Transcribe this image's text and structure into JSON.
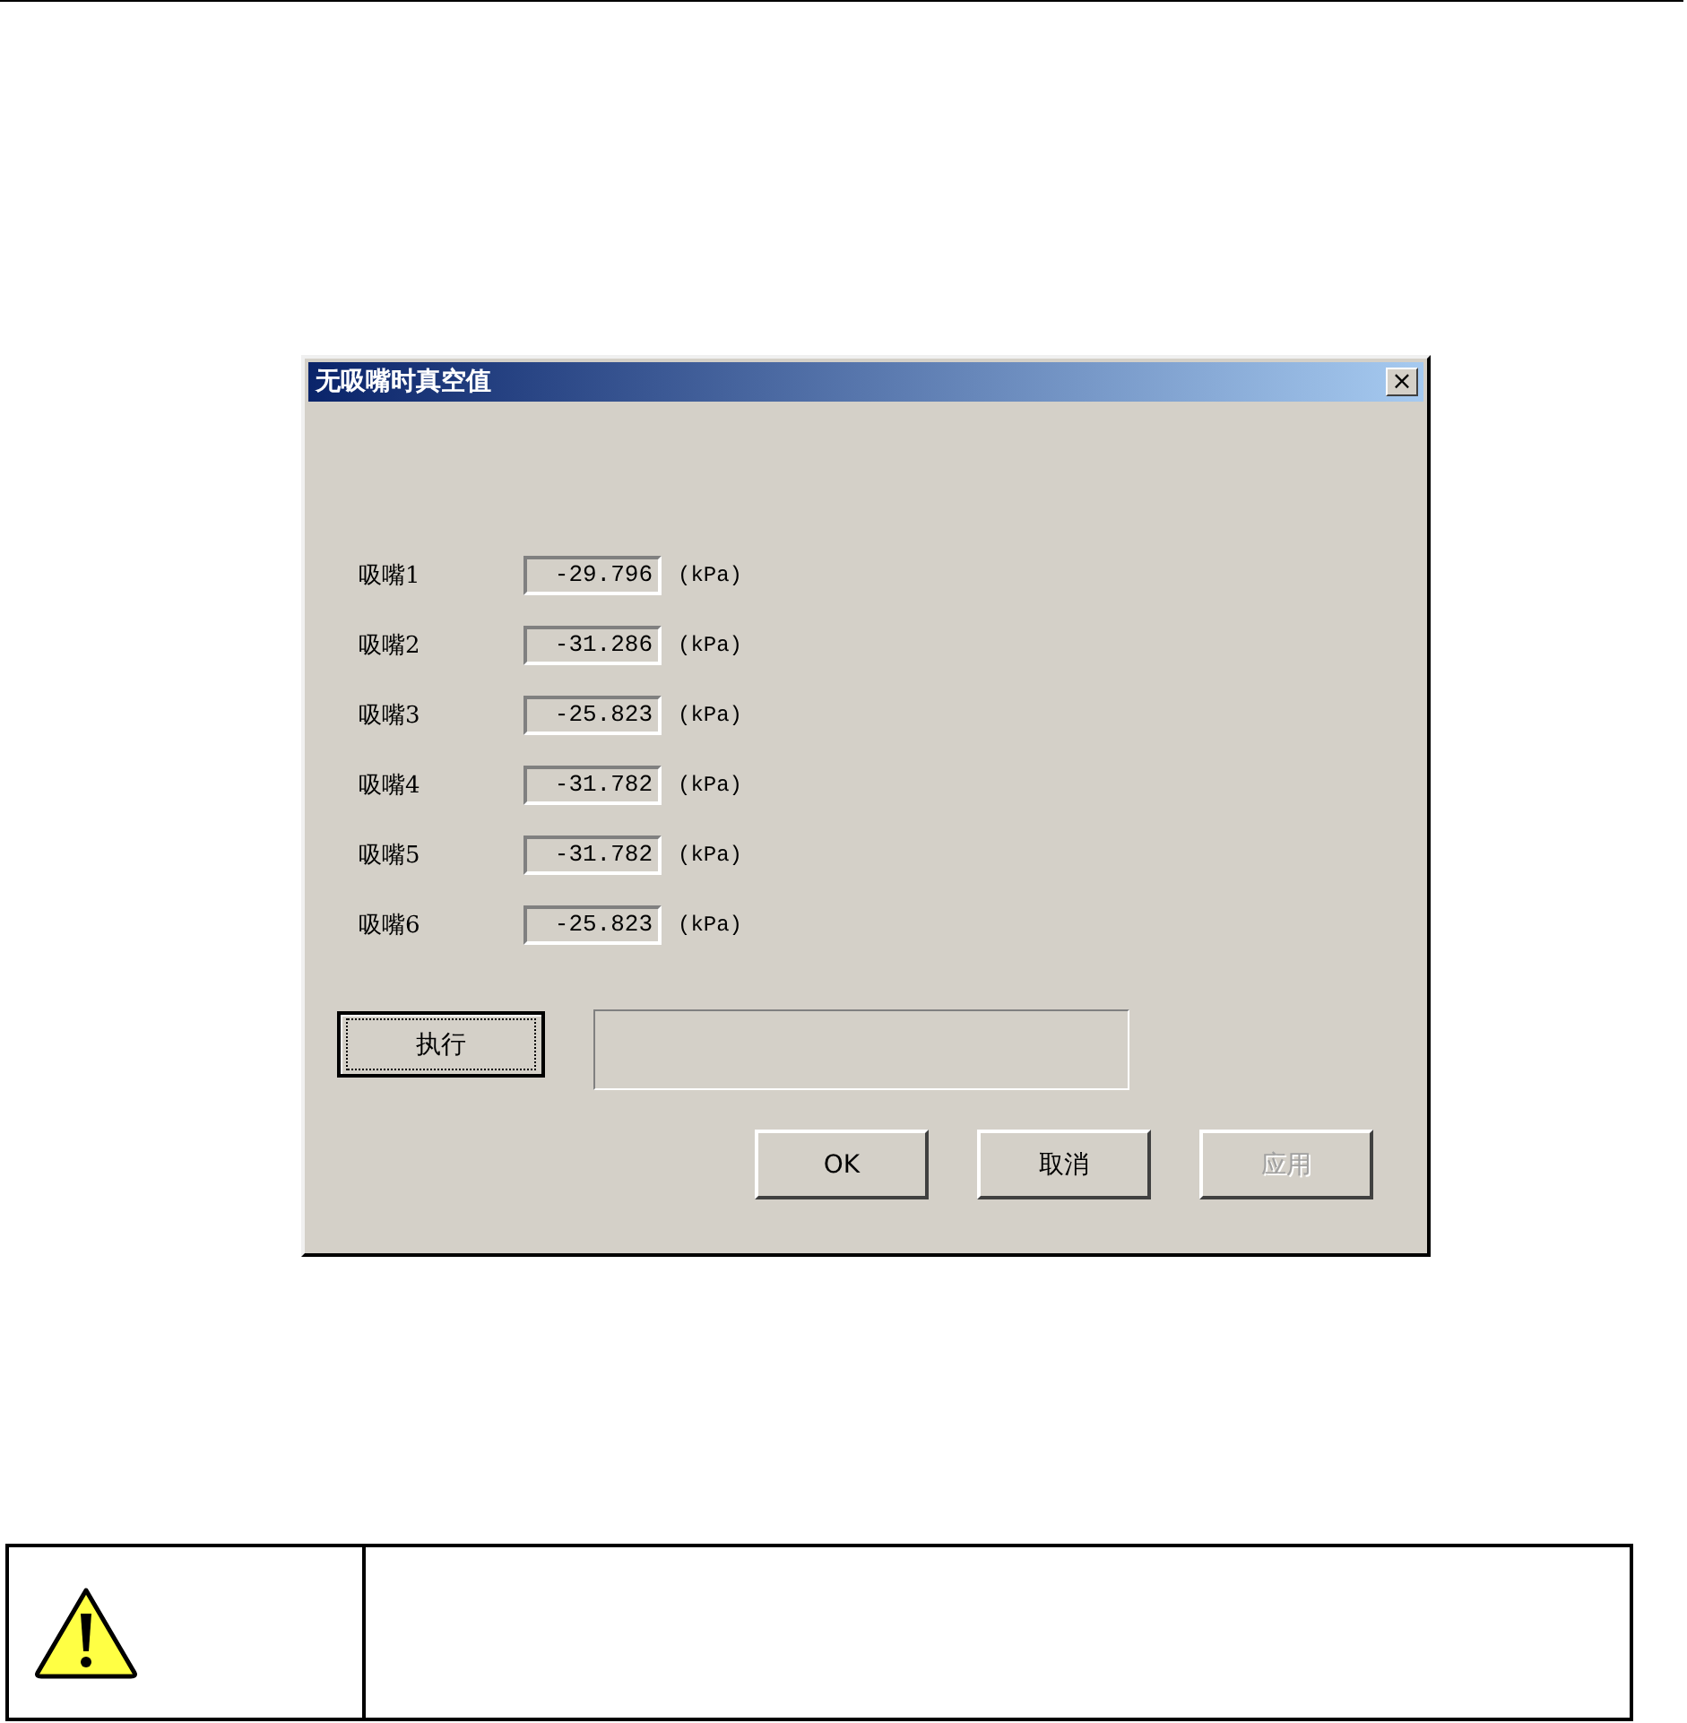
{
  "dialog": {
    "title": "无吸嘴时真空值",
    "close": "×"
  },
  "nozzles": [
    {
      "label": "吸嘴1",
      "value": "-29.796",
      "unit": "(kPa)"
    },
    {
      "label": "吸嘴2",
      "value": "-31.286",
      "unit": "(kPa)"
    },
    {
      "label": "吸嘴3",
      "value": "-25.823",
      "unit": "(kPa)"
    },
    {
      "label": "吸嘴4",
      "value": "-31.782",
      "unit": "(kPa)"
    },
    {
      "label": "吸嘴5",
      "value": "-31.782",
      "unit": "(kPa)"
    },
    {
      "label": "吸嘴6",
      "value": "-25.823",
      "unit": "(kPa)"
    }
  ],
  "execute_button": {
    "label": "执行",
    "focused": true
  },
  "buttons": [
    {
      "label": "OK",
      "disabled": false
    },
    {
      "label": "取消",
      "disabled": false
    },
    {
      "label": "应用",
      "disabled": true
    }
  ]
}
